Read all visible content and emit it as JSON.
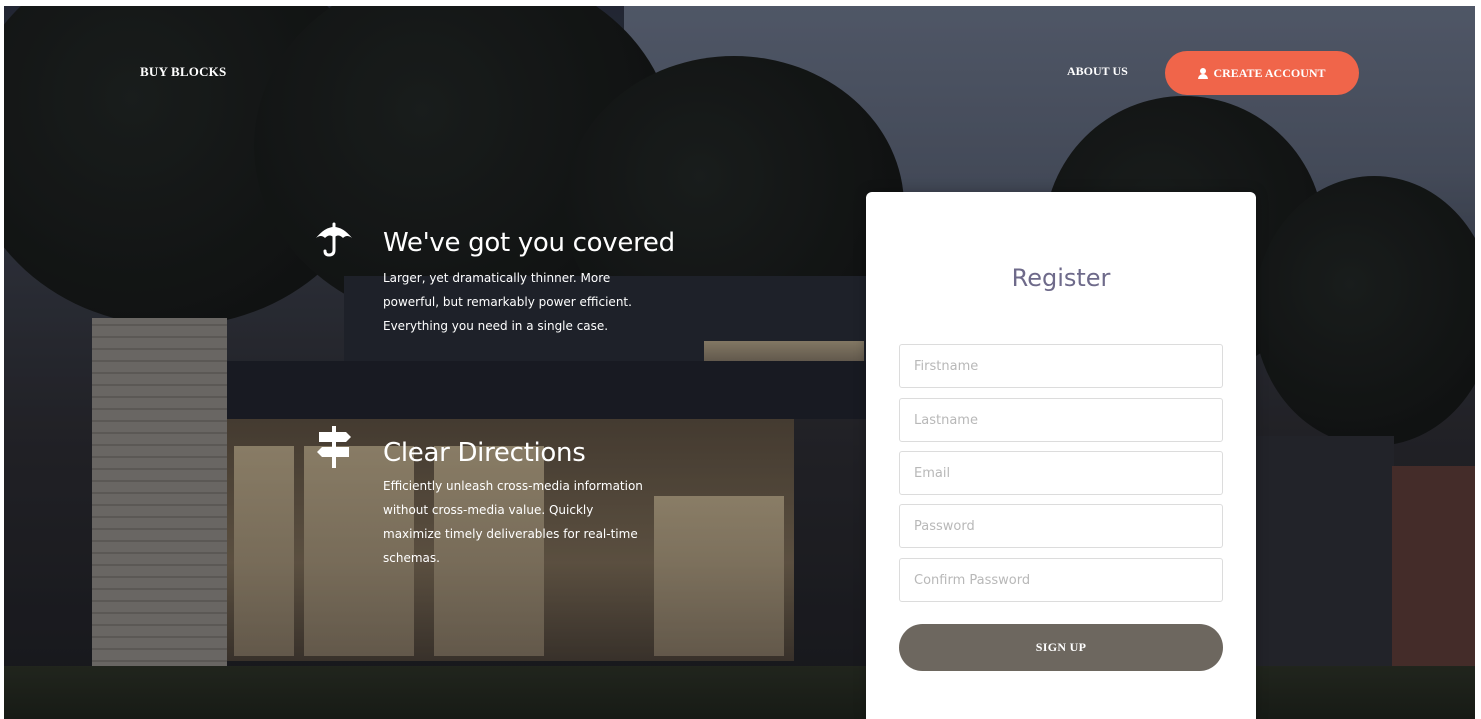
{
  "navbar": {
    "brand": "BUY BLOCKS",
    "about": "ABOUT US",
    "create_account": "CREATE ACCOUNT"
  },
  "features": [
    {
      "icon": "umbrella-icon",
      "title": "We've got you covered",
      "lines": [
        "Larger, yet dramatically thinner. More",
        "powerful, but remarkably power efficient.",
        "Everything you need in a single case."
      ]
    },
    {
      "icon": "signpost-icon",
      "title": "Clear Directions",
      "lines": [
        "Efficiently unleash cross-media information",
        "without cross-media value. Quickly",
        "maximize timely deliverables for real-time",
        "schemas."
      ]
    }
  ],
  "register": {
    "title": "Register",
    "firstname_placeholder": "Firstname",
    "lastname_placeholder": "Lastname",
    "email_placeholder": "Email",
    "password_placeholder": "Password",
    "confirm_password_placeholder": "Confirm Password",
    "signup_label": "SIGN UP"
  },
  "colors": {
    "accent": "#f0654a",
    "button": "#6d675f",
    "title": "#6e6a8a"
  }
}
